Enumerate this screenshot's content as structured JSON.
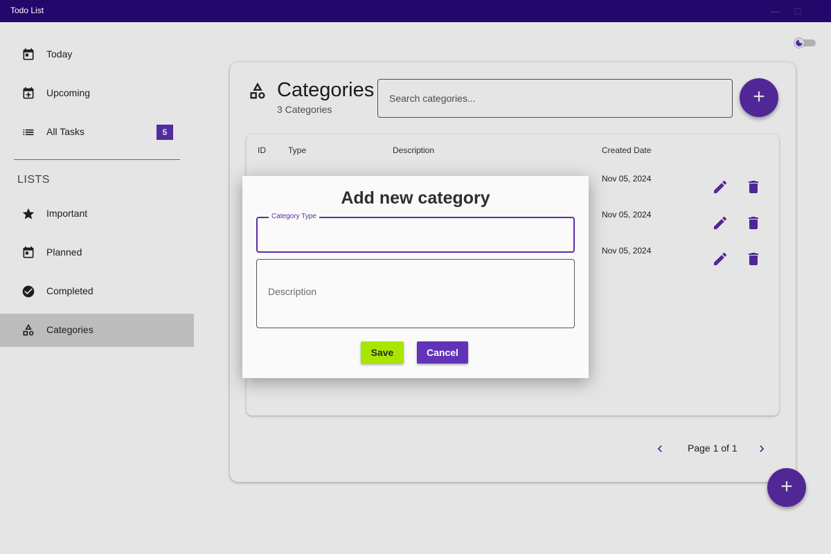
{
  "window": {
    "title": "Todo List",
    "controls": [
      "minimize-icon",
      "maximize-icon"
    ]
  },
  "sidebar": {
    "items": [
      {
        "label": "Today",
        "icon": "calendar-today-icon"
      },
      {
        "label": "Upcoming",
        "icon": "calendar-add-icon"
      },
      {
        "label": "All Tasks",
        "icon": "list-icon",
        "badge": "5"
      }
    ],
    "lists_heading": "LISTS",
    "lists": [
      {
        "label": "Important",
        "icon": "star-icon"
      },
      {
        "label": "Planned",
        "icon": "calendar-icon"
      },
      {
        "label": "Completed",
        "icon": "check-circle-icon"
      },
      {
        "label": "Categories",
        "icon": "shapes-icon",
        "active": true
      }
    ]
  },
  "theme_toggle": {
    "icon": "dark-mode-icon",
    "state": "off"
  },
  "main": {
    "title": "Categories",
    "subtitle": "3 Categories",
    "search_placeholder": "Search categories...",
    "table": {
      "headers": [
        "ID",
        "Type",
        "Description",
        "Created Date"
      ],
      "rows": [
        {
          "created_date": "Nov 05, 2024"
        },
        {
          "created_date": "Nov 05, 2024"
        },
        {
          "created_date": "Nov 05, 2024"
        }
      ]
    },
    "pagination": {
      "text": "Page 1 of 1"
    }
  },
  "dialog": {
    "title": "Add new category",
    "category_type_label": "Category Type",
    "category_type_value": "",
    "description_placeholder": "Description",
    "save_label": "Save",
    "cancel_label": "Cancel"
  },
  "colors": {
    "accent": "#5b2ca8",
    "titlebar": "#23076b",
    "save_button": "#a8e600",
    "cancel_button": "#6233b8"
  }
}
